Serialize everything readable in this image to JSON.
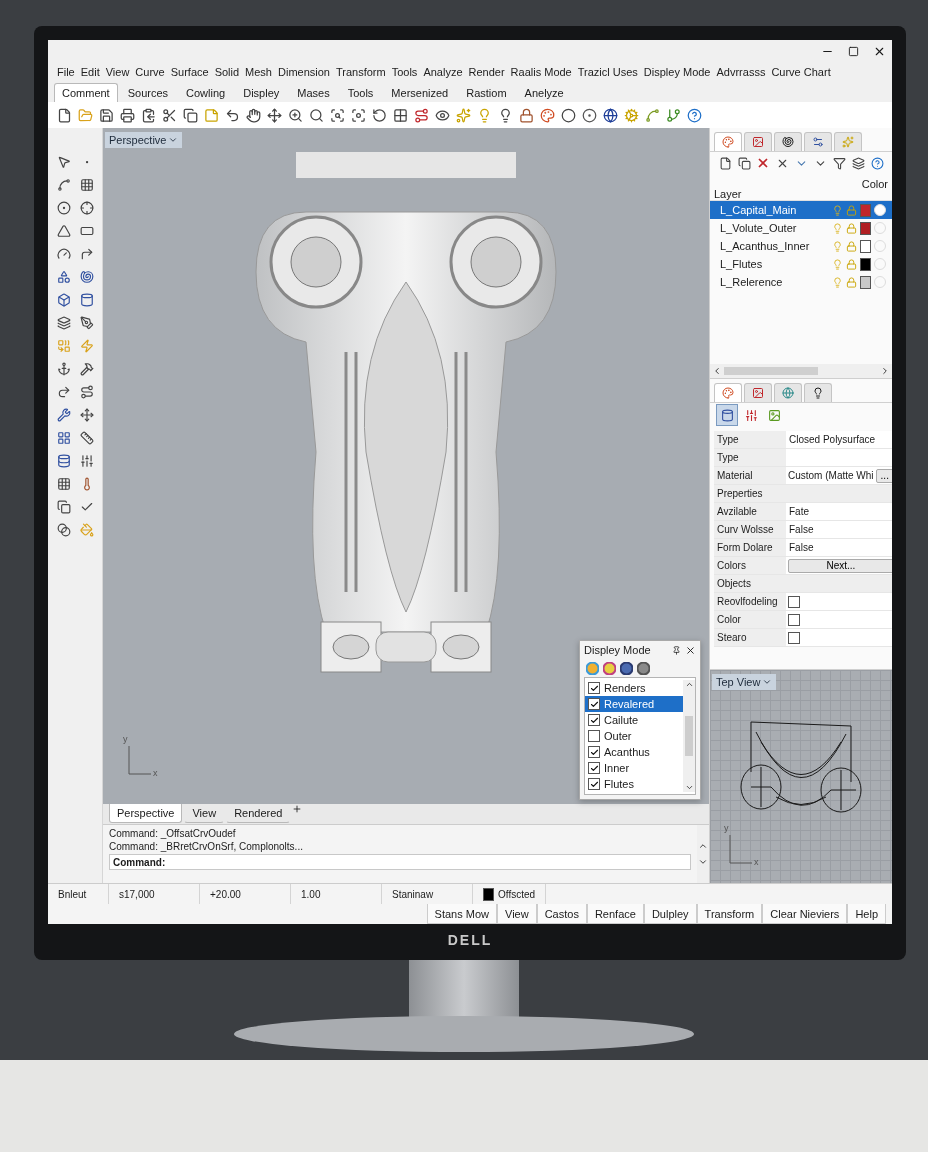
{
  "menu": [
    "File",
    "Edit",
    "View",
    "Curve",
    "Surface",
    "Solid",
    "Mesh",
    "Dimension",
    "Transform",
    "Tools",
    "Analyze",
    "Render",
    "Raalis Mode",
    "Trazicl Uses",
    "Displey Mode",
    "Advrrasss",
    "Curve Chart"
  ],
  "ribbon_tabs": [
    {
      "label": "Comment",
      "selected": true
    },
    {
      "label": "Sources",
      "selected": false
    },
    {
      "label": "Cowling",
      "selected": false
    },
    {
      "label": "Displey",
      "selected": false
    },
    {
      "label": "Mases",
      "selected": false
    },
    {
      "label": "Tools",
      "selected": false
    },
    {
      "label": "Mersenized",
      "selected": false
    },
    {
      "label": "Rastiom",
      "selected": false
    },
    {
      "label": "Anelyze",
      "selected": false
    }
  ],
  "viewport": {
    "label": "Perspective",
    "axis": [
      "y",
      "x"
    ],
    "tabs": [
      {
        "label": "Perspective",
        "selected": true
      },
      {
        "label": "View",
        "selected": false
      },
      {
        "label": "Rendered",
        "selected": false
      }
    ]
  },
  "display_mode": {
    "title": "Displey Mode",
    "items": [
      {
        "label": "Renders",
        "checked": true,
        "selected": false
      },
      {
        "label": "Revalered",
        "checked": true,
        "selected": true
      },
      {
        "label": "Cailute",
        "checked": true,
        "selected": false
      },
      {
        "label": "Outer",
        "checked": false,
        "selected": false
      },
      {
        "label": "Acanthus",
        "checked": true,
        "selected": false
      },
      {
        "label": "Inner",
        "checked": true,
        "selected": false
      },
      {
        "label": "Flutes",
        "checked": true,
        "selected": false
      }
    ]
  },
  "command": {
    "history": [
      "Command: _OffsatCrvOudef",
      "Command: _BRretCrvOnSrf, Complonolts..."
    ],
    "prompt": "Command:"
  },
  "status_bar": {
    "cells": [
      "Bnleut",
      "s17,000",
      "+20.00",
      "1.00",
      "Staninaw"
    ],
    "layer": {
      "label": "Offscted",
      "color": "#000000"
    }
  },
  "bottom_tabs": [
    "Stans Mow",
    "View",
    "Castos",
    "Renface",
    "Dulpley",
    "Transform",
    "Clear Nieviers",
    "Help"
  ],
  "layers": {
    "header": "Layer",
    "color_header": "Color",
    "rows": [
      {
        "name": "L_Capital_Main",
        "selected": true,
        "color": "#c0262b"
      },
      {
        "name": "L_Volute_Outer",
        "selected": false,
        "color": "#b01e22"
      },
      {
        "name": "L_Acanthus_Inner",
        "selected": false,
        "color": "#ffffff"
      },
      {
        "name": "L_Flutes",
        "selected": false,
        "color": "#000000"
      },
      {
        "name": "L_Relerence",
        "selected": false,
        "color": "#c8c8c8"
      }
    ]
  },
  "properties": {
    "rows": [
      {
        "kind": "field",
        "label": "Type",
        "value": "Closed Polysurface"
      },
      {
        "kind": "field",
        "label": "Type"
      },
      {
        "kind": "material",
        "label": "Material",
        "value": "Custom (Matte Whi",
        "button": "..."
      },
      {
        "kind": "section",
        "label": "Preperties"
      },
      {
        "kind": "field",
        "label": "Avzilable",
        "value": "Fate"
      },
      {
        "kind": "field",
        "label": "Curv Wolsse",
        "value": "False"
      },
      {
        "kind": "field",
        "label": "Form Dolare",
        "value": "False"
      },
      {
        "kind": "button",
        "label": "Colors",
        "button": "Next..."
      },
      {
        "kind": "section",
        "label": "Objects"
      },
      {
        "kind": "checkbox",
        "label": "Reovlfodeling",
        "checked": false
      },
      {
        "kind": "checkbox",
        "label": "Color",
        "checked": false
      },
      {
        "kind": "checkbox",
        "label": "Stearo",
        "checked": false
      }
    ]
  },
  "top_view": {
    "label": "Tep View",
    "axis": [
      "y",
      "x"
    ]
  },
  "monitor": {
    "brand": "DELL"
  }
}
